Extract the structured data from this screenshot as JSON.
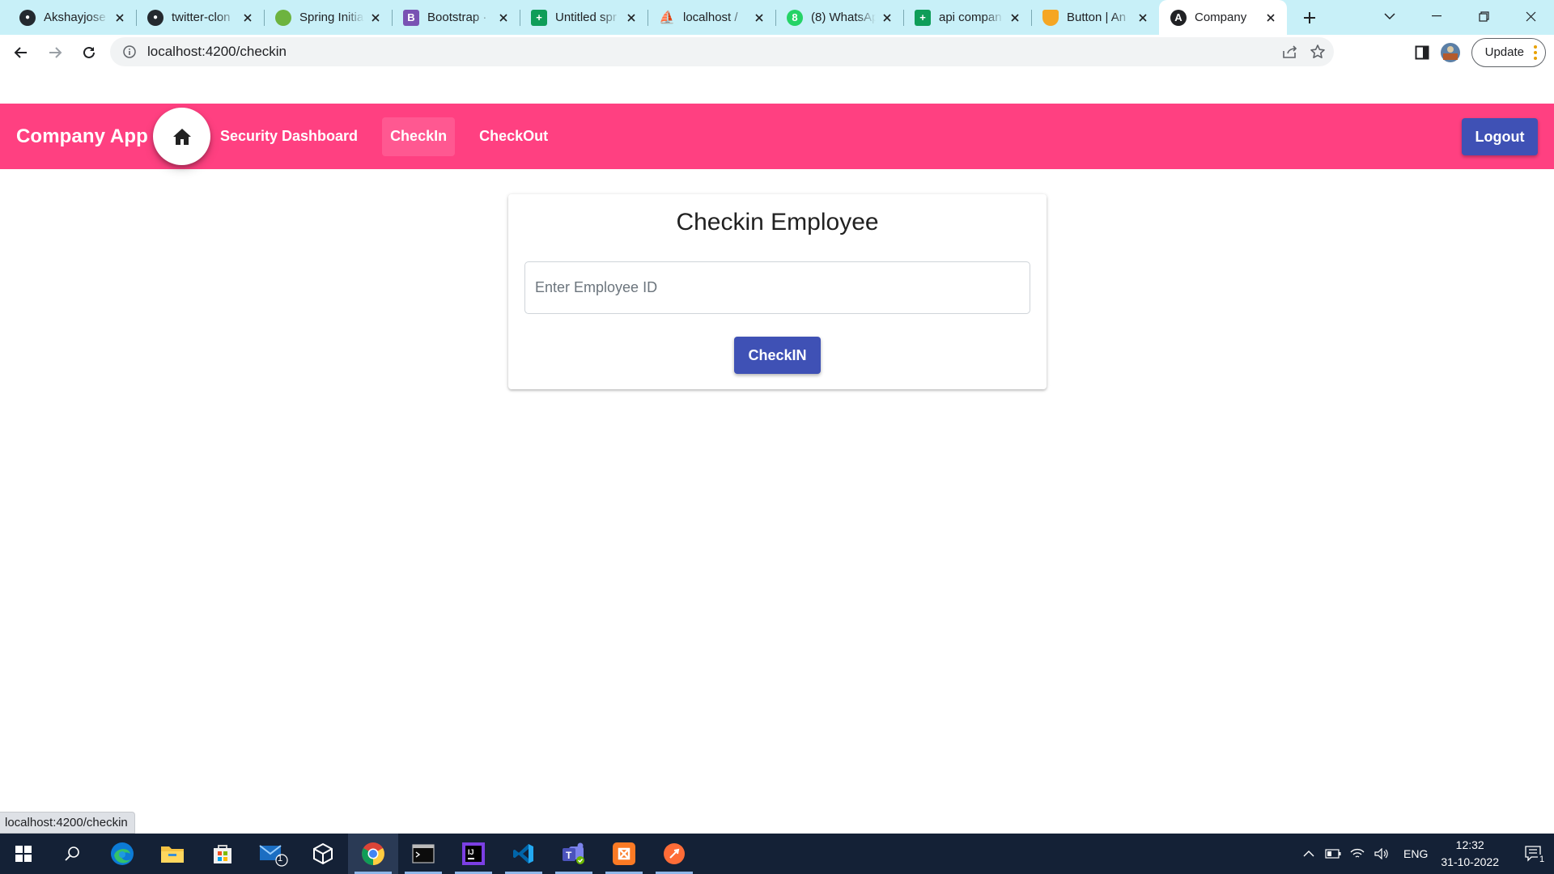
{
  "browser": {
    "tabs": [
      {
        "title": "Akshayjose",
        "favicon": "github-icon",
        "fav_color": "#24292f",
        "fav_glyph": ""
      },
      {
        "title": "twitter-clon",
        "favicon": "github-icon",
        "fav_color": "#24292f",
        "fav_glyph": ""
      },
      {
        "title": "Spring Initia",
        "favicon": "spring-icon",
        "fav_color": "#6db33f",
        "fav_glyph": ""
      },
      {
        "title": "Bootstrap ·",
        "favicon": "bootstrap-icon",
        "fav_color": "#7952b3",
        "fav_glyph": "B"
      },
      {
        "title": "Untitled spr",
        "favicon": "sheets-icon",
        "fav_color": "#0f9d58",
        "fav_glyph": "+"
      },
      {
        "title": "localhost /",
        "favicon": "phpmyadmin-icon",
        "fav_color": "#f89c0e",
        "fav_glyph": ""
      },
      {
        "title": "(8) WhatsAp",
        "favicon": "whatsapp-icon",
        "fav_color": "#25d366",
        "fav_glyph": "8"
      },
      {
        "title": "api compan",
        "favicon": "sheets-icon",
        "fav_color": "#0f9d58",
        "fav_glyph": "+"
      },
      {
        "title": "Button | An",
        "favicon": "shield-icon",
        "fav_color": "#f5a623",
        "fav_glyph": ""
      },
      {
        "title": "Company",
        "favicon": "angular-icon",
        "fav_color": "#202124",
        "fav_glyph": "A",
        "active": true
      }
    ],
    "url": "localhost:4200/checkin",
    "update_label": "Update",
    "status_url": "localhost:4200/checkin"
  },
  "app": {
    "brand": "Company App .",
    "nav": {
      "security": "Security Dashboard",
      "checkin": "CheckIn",
      "checkout": "CheckOut"
    },
    "logout_label": "Logout",
    "colors": {
      "toolbar": "#ff4081",
      "primary": "#3f51b5"
    }
  },
  "checkin_card": {
    "title": "Checkin Employee",
    "input_placeholder": "Enter Employee ID",
    "input_value": "",
    "button_label": "CheckIN"
  },
  "taskbar": {
    "apps": [
      "start-icon",
      "search-icon",
      "edge-icon",
      "file-explorer-icon",
      "store-icon",
      "mail-icon",
      "virtualbox-icon",
      "chrome-icon",
      "terminal-icon",
      "intellij-icon",
      "vscode-icon",
      "teams-icon",
      "xampp-icon",
      "postman-icon"
    ],
    "mail_badge": "1",
    "language": "ENG",
    "time": "12:32",
    "date": "31-10-2022",
    "notification_count": "1"
  }
}
